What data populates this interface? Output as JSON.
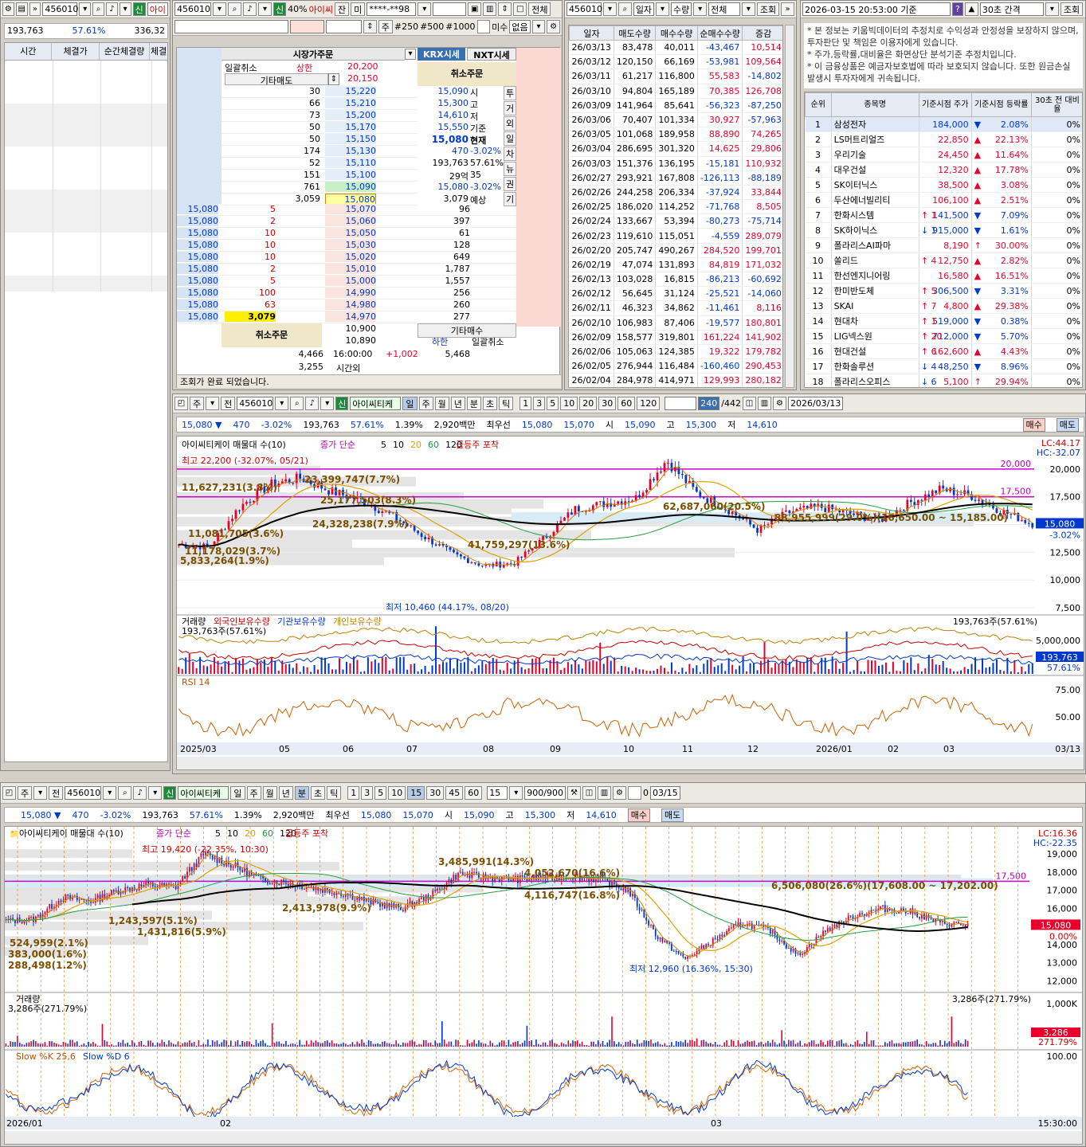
{
  "p1": {
    "code": "456010",
    "name": "아이",
    "price": "193,763",
    "ratio": "57.61%",
    "vol": "336,32",
    "cols": [
      "시간",
      "체결가",
      "순간체결량",
      "체결"
    ]
  },
  "p2": {
    "code": "456010",
    "badge": "신",
    "pct": "40%",
    "name": "아이씨",
    "jan": "잔",
    "mi": "미",
    "acct": "****-**98",
    "all": "전체",
    "ju": "주",
    "qty": [
      "#250",
      "#500",
      "#1000"
    ],
    "misu": "미수",
    "none": "없음",
    "title": "시장가주문",
    "krx": "KRX시세",
    "nxt": "NXT시세",
    "cancel_all": "일괄취소",
    "upper": "상한",
    "upper_v": "20,200",
    "etc_sell": "기타매도",
    "etc_sell_v": "20,150",
    "cancel": "취소주문",
    "cancel2": "취소주문",
    "etc_buy": "기타매수",
    "lower": "하한",
    "cancel_all2": "일괄취소",
    "asks": [
      [
        "30",
        "15,220"
      ],
      [
        "66",
        "15,210"
      ],
      [
        "73",
        "15,200"
      ],
      [
        "50",
        "15,170"
      ],
      [
        "50",
        "15,150"
      ],
      [
        "174",
        "15,130"
      ],
      [
        "52",
        "15,110"
      ],
      [
        "151",
        "15,100"
      ],
      [
        "761",
        "15,090"
      ],
      [
        "3,059",
        "15,080"
      ]
    ],
    "bids": [
      [
        "15,080",
        "5",
        "15,070",
        "96"
      ],
      [
        "15,080",
        "2",
        "15,060",
        "397"
      ],
      [
        "15,080",
        "10",
        "15,050",
        "61"
      ],
      [
        "15,080",
        "10",
        "15,030",
        "128"
      ],
      [
        "15,080",
        "10",
        "15,020",
        "649"
      ],
      [
        "15,080",
        "2",
        "15,010",
        "1,787"
      ],
      [
        "15,080",
        "5",
        "15,000",
        "1,557"
      ],
      [
        "15,080",
        "100",
        "14,990",
        "256"
      ],
      [
        "15,080",
        "63",
        "14,980",
        "260"
      ],
      [
        "15,080",
        "3,079",
        "14,970",
        "277"
      ]
    ],
    "info": [
      [
        "15,090",
        "시"
      ],
      [
        "15,300",
        "고"
      ],
      [
        "14,610",
        "저"
      ],
      [
        "15,550",
        "기준"
      ],
      [
        "15,080",
        "현재"
      ],
      [
        "470",
        "-3.02%"
      ],
      [
        "193,763",
        "57.61%"
      ],
      [
        "29억",
        "35"
      ],
      [
        "15,080",
        "-3.02%"
      ],
      [
        "3,079",
        "예상"
      ]
    ],
    "tabs": [
      "투",
      "거",
      "외",
      "일",
      "차",
      "뉴",
      "권",
      "기"
    ],
    "low1": "10,900",
    "low2": "10,890",
    "tot1": "4,466",
    "time": "16:00:00",
    "diff": "+1,002",
    "tot2": "5,468",
    "tot3": "3,255",
    "after": "시간외",
    "status": "조회가 완료 되었습니다."
  },
  "p3": {
    "code": "456010",
    "sel1": "일자",
    "sel2": "수량",
    "sel3": "전체",
    "query": "조회",
    "cols": [
      "일자",
      "매도수량",
      "매수수량",
      "순매수수량",
      "증감"
    ],
    "rows": [
      [
        "26/03/13",
        "83,478",
        "40,011",
        "-43,467",
        "10,514"
      ],
      [
        "26/03/12",
        "120,150",
        "66,169",
        "-53,981",
        "109,564"
      ],
      [
        "26/03/11",
        "61,217",
        "116,800",
        "55,583",
        "-14,802"
      ],
      [
        "26/03/10",
        "94,804",
        "165,189",
        "70,385",
        "126,708"
      ],
      [
        "26/03/09",
        "141,964",
        "85,641",
        "-56,323",
        "-87,250"
      ],
      [
        "26/03/06",
        "70,407",
        "101,334",
        "30,927",
        "-57,963"
      ],
      [
        "26/03/05",
        "101,068",
        "189,958",
        "88,890",
        "74,265"
      ],
      [
        "26/03/04",
        "286,695",
        "301,320",
        "14,625",
        "29,806"
      ],
      [
        "26/03/03",
        "151,376",
        "136,195",
        "-15,181",
        "110,932"
      ],
      [
        "26/02/27",
        "293,921",
        "167,808",
        "-126,113",
        "-88,189"
      ],
      [
        "26/02/26",
        "244,258",
        "206,334",
        "-37,924",
        "33,844"
      ],
      [
        "26/02/25",
        "186,020",
        "114,252",
        "-71,768",
        "8,505"
      ],
      [
        "26/02/24",
        "133,667",
        "53,394",
        "-80,273",
        "-75,714"
      ],
      [
        "26/02/23",
        "119,610",
        "115,051",
        "-4,559",
        "289,079"
      ],
      [
        "26/02/20",
        "205,747",
        "490,267",
        "284,520",
        "199,701"
      ],
      [
        "26/02/19",
        "47,074",
        "131,893",
        "84,819",
        "171,032"
      ],
      [
        "26/02/13",
        "103,028",
        "16,815",
        "-86,213",
        "-60,692"
      ],
      [
        "26/02/12",
        "56,645",
        "31,124",
        "-25,521",
        "-14,060"
      ],
      [
        "26/02/11",
        "46,323",
        "34,862",
        "-11,461",
        "8,116"
      ],
      [
        "26/02/10",
        "106,983",
        "87,406",
        "-19,577",
        "180,801"
      ],
      [
        "26/02/09",
        "158,577",
        "319,801",
        "161,224",
        "141,902"
      ],
      [
        "26/02/06",
        "105,063",
        "124,385",
        "19,322",
        "179,782"
      ],
      [
        "26/02/05",
        "276,944",
        "116,484",
        "-160,460",
        "290,453"
      ],
      [
        "26/02/04",
        "284,978",
        "414,971",
        "129,993",
        "280,182"
      ]
    ]
  },
  "p4": {
    "datetime": "2026-03-15 20:53:00 기준",
    "help": "?",
    "interval": "30초 간격",
    "query": "조회",
    "notice": [
      "본 정보는 키움빅데이터의 추정치로 수익성과 안정성을 보장하지 않으며, 투자판단 및 책임은 이용자에게 있습니다.",
      "주가,등락률,대비율은 화면상단 분석기준 추정치입니다.",
      "이 금융상품은 예금자보호법에 따라 보호되지 않습니다. 또한 원금손실 발생시 투자자에게 귀속됩니다."
    ],
    "cols": [
      "순위",
      "종목명",
      "기준시점 주가",
      "기준시점 등락률",
      "30초 전 대비율"
    ],
    "rows": [
      [
        "1",
        "삼성전자",
        "",
        "184,000",
        "▼",
        "2.08%",
        "0%"
      ],
      [
        "2",
        "LS머트리얼즈",
        "",
        "22,850",
        "▲",
        "22.13%",
        "0%"
      ],
      [
        "3",
        "우리기술",
        "",
        "24,450",
        "▲",
        "11.64%",
        "0%"
      ],
      [
        "4",
        "대우건설",
        "",
        "12,320",
        "▲",
        "17.78%",
        "0%"
      ],
      [
        "5",
        "SK이터닉스",
        "",
        "38,500",
        "▲",
        "3.08%",
        "0%"
      ],
      [
        "6",
        "두산에너빌리티",
        "",
        "106,100",
        "▲",
        "2.51%",
        "0%"
      ],
      [
        "7",
        "한화시스템",
        "↑ 1",
        "141,500",
        "▼",
        "7.09%",
        "0%"
      ],
      [
        "8",
        "SK하이닉스",
        "↓ 1",
        "915,000",
        "▼",
        "1.61%",
        "0%"
      ],
      [
        "9",
        "폴라리스AI파마",
        "",
        "8,190",
        "↑",
        "30.00%",
        "0%"
      ],
      [
        "10",
        "쏠리드",
        "↑ 4",
        "12,750",
        "▲",
        "2.82%",
        "0%"
      ],
      [
        "11",
        "한선엔지니어링",
        "",
        "16,580",
        "▲",
        "16.51%",
        "0%"
      ],
      [
        "12",
        "한미반도체",
        "↑ 5",
        "306,500",
        "▼",
        "3.31%",
        "0%"
      ],
      [
        "13",
        "SKAI",
        "↑ 7",
        "4,800",
        "▲",
        "29.38%",
        "0%"
      ],
      [
        "14",
        "현대차",
        "↑ 1",
        "519,000",
        "▼",
        "0.38%",
        "0%"
      ],
      [
        "15",
        "LIG넥스원",
        "↑ 20",
        "712,000",
        "▼",
        "5.70%",
        "0%"
      ],
      [
        "16",
        "현대건설",
        "↑ 6",
        "162,600",
        "▲",
        "4.43%",
        "0%"
      ],
      [
        "17",
        "한화솔루션",
        "↓ 4",
        "48,250",
        "▼",
        "8.96%",
        "0%"
      ],
      [
        "18",
        "폴라리스오피스",
        "↓ 6",
        "5,100",
        "↑",
        "29.94%",
        "0%"
      ]
    ]
  },
  "c1": {
    "ju": "주",
    "jeon": "전",
    "code": "456010",
    "badge": "신",
    "name": "아이씨티케",
    "periods": [
      "일",
      "주",
      "월",
      "년",
      "분",
      "초",
      "틱"
    ],
    "nums": [
      "1",
      "3",
      "5",
      "10",
      "20",
      "30",
      "60",
      "120"
    ],
    "count": "240",
    "total": "/442",
    "date": "2026/03/13",
    "q": [
      "15,080 ▼",
      "470",
      "-3.02%",
      "193,763",
      "57.61%",
      "1.39%",
      "2,920백만",
      "최우선",
      "15,080",
      "15,070",
      "시",
      "15,090",
      "고",
      "15,300",
      "저",
      "14,610"
    ],
    "buy": "매수",
    "sell": "매도",
    "legend1": "아이씨티케이 매물대 수(10)",
    "legend2": "종가 단순",
    "ma": [
      "5",
      "10",
      "20",
      "60",
      "120"
    ],
    "legend3": "급등주 포착",
    "lc": "LC:44.17",
    "hc": "HC:-32.07",
    "max": "최고 22,200 (-32.07%, 05/21)",
    "min": "최저 10,460 (44.17%, 08/20)",
    "labels": [
      "11,627,231(3.8%)",
      "23,399,747(7.7%)",
      "25,177,503(8.3%)",
      "24,328,238(7.9%)",
      "11,081,705(3.6%)",
      "11,178,029(3.7%)",
      "5,833,264(1.9%)",
      "41,759,297(13.6%)",
      "62,687,060(20.5%)",
      "88,955,999(29.0%)(16,650.00 ~ 15,185.00)"
    ],
    "yaxis": [
      "20,000",
      "17,500",
      "15,000",
      "12,500",
      "10,000",
      "7,500"
    ],
    "ylines": [
      "20,000",
      "17,500"
    ],
    "cur": "15,080",
    "curpct": "-3.02%",
    "vlegend": [
      "거래량",
      "외국인보유수량",
      "기관보유수량",
      "개인보유수량"
    ],
    "vinfo": "193,763주(57.61%)",
    "vaxis": "5,000,000",
    "vcur": "193,763",
    "vcurpct": "57.61%",
    "rsi": "RSI 14",
    "rsiaxis": [
      "75.00",
      "50.00"
    ],
    "xaxis": [
      "2025/03",
      "05",
      "06",
      "07",
      "08",
      "09",
      "10",
      "11",
      "12",
      "2026/01",
      "02",
      "03"
    ],
    "lastdate": "03/13"
  },
  "c2": {
    "ju": "주",
    "jeon": "전",
    "code": "456010",
    "badge": "신",
    "name": "아이씨티케",
    "periods": [
      "일",
      "주",
      "월",
      "년",
      "분",
      "초",
      "틱"
    ],
    "nums": [
      "1",
      "3",
      "5",
      "10",
      "15",
      "30",
      "45",
      "60"
    ],
    "sel": "15",
    "count": "900/900",
    "chk": "0",
    "date": "03/15",
    "q": [
      "15,080 ▼",
      "470",
      "-3.02%",
      "193,763",
      "57.61%",
      "1.39%",
      "2,920백만",
      "최우선",
      "15,080",
      "15,070",
      "시",
      "15,090",
      "고",
      "15,300",
      "저",
      "14,610"
    ],
    "buy": "매수",
    "sell": "매도",
    "legend1": "아이씨티케이 매물대 수(10)",
    "legend2": "종가 단순",
    "ma": [
      "5",
      "10",
      "20",
      "60",
      "120"
    ],
    "legend3": "급등주 포착",
    "lc": "LC:16.36",
    "hc": "HC:-22.35",
    "max": "최고 19,420 (-22.35%, 10:30)",
    "min": "최저 12,960 (16.36%, 15:30)",
    "labels": [
      "3,485,991(14.3%)",
      "4,052,670(16.6%)",
      "4,116,747(16.8%)",
      "6,506,080(26.6%)(17,608.00 ~ 17,202.00)",
      "2,413,978(9.9%)",
      "1,243,597(5.1%)",
      "1,431,816(5.9%)",
      "524,959(2.1%)",
      "383,000(1.6%)",
      "288,498(1.2%)"
    ],
    "yaxis": [
      "19,000",
      "18,000",
      "17,000",
      "16,000",
      "15,000",
      "14,000",
      "13,000",
      "12,000"
    ],
    "yline": "17,500",
    "cur": "15,080",
    "curpct": "0.00%",
    "vlegend": "거래량",
    "vinfo": "3,286주(271.79%)",
    "vlabel": "3,286주(271.79%)",
    "vaxis": "1,000K",
    "vcur": "3,286",
    "vcurpct": "271.79%",
    "slow": "Slow %K 25,6",
    "slowd": "Slow %D 6",
    "saxis": "100.00",
    "xaxis": [
      "2026/01",
      "02",
      "03"
    ],
    "lasttime": "15:30:00"
  }
}
